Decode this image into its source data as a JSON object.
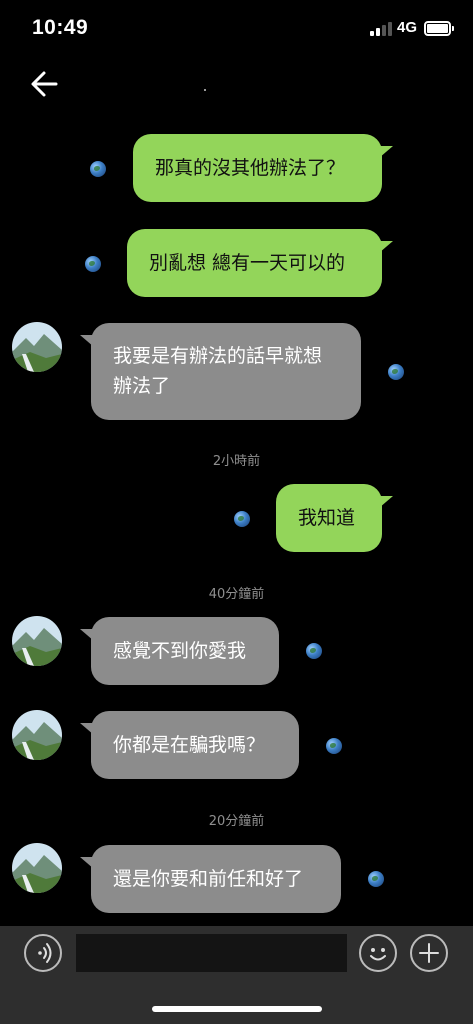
{
  "status_bar": {
    "time": "10:49",
    "network": "4G",
    "signal_bars": 4,
    "signal_active": 2,
    "battery_level": 1.0
  },
  "header": {
    "back_icon": "arrow-left-icon"
  },
  "messages": [
    {
      "side": "out",
      "text": "那真的沒其他辦法了？"
    },
    {
      "side": "out",
      "text": "別亂想 總有一天可以的"
    },
    {
      "side": "in",
      "text": "我要是有辦法的話早就想\n辦法了"
    },
    {
      "side": "out",
      "text": "我知道"
    },
    {
      "side": "in",
      "text": "感覺不到你愛我"
    },
    {
      "side": "in",
      "text": "你都是在騙我嗎？"
    },
    {
      "side": "in",
      "text": "還是你要和前任和好了"
    }
  ],
  "timestamps": [
    "2小時前",
    "40分鐘前",
    "20分鐘前"
  ],
  "input_bar": {
    "voice_icon": "voice-icon",
    "emoji_icon": "emoji-icon",
    "plus_icon": "plus-icon",
    "input_placeholder": ""
  },
  "colors": {
    "outgoing_bubble": "#93d55a",
    "incoming_bubble": "#8c8c8c",
    "background": "#000000",
    "input_bar": "#2e2e2e"
  }
}
